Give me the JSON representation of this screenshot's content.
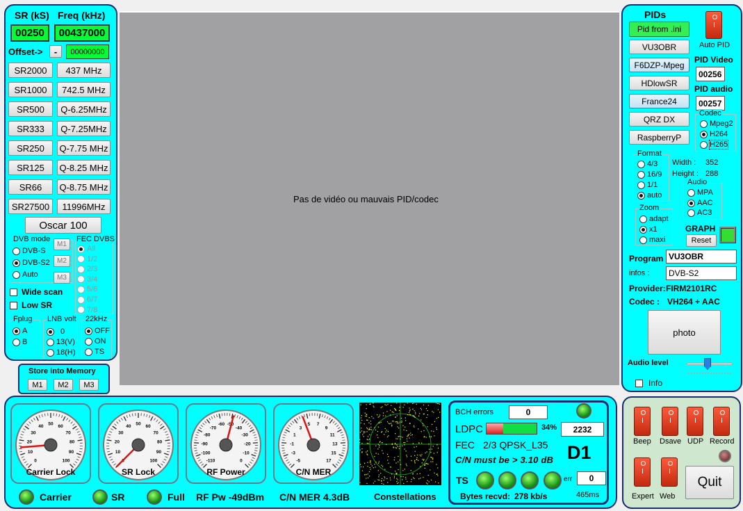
{
  "left": {
    "sr_header": "SR (kS)",
    "freq_header": "Freq (kHz)",
    "sr_value": "00250",
    "freq_value": "00437000",
    "offset_label": "Offset->",
    "offset_sign": "-",
    "offset_value": "00000000",
    "sr_buttons": [
      "SR2000",
      "SR1000",
      "SR500",
      "SR333",
      "SR250",
      "SR125",
      "SR66",
      "SR27500"
    ],
    "freq_buttons": [
      "437 MHz",
      "742.5 MHz",
      "Q-6.25MHz",
      "Q-7.25MHz",
      "Q-7.75 MHz",
      "Q-8.25 MHz",
      "Q-8.75 MHz",
      "11996MHz"
    ],
    "oscar_button": "Oscar 100",
    "dvb_mode": {
      "legend": "DVB mode",
      "options": [
        "DVB-S",
        "DVB-S2",
        "Auto"
      ],
      "selected": "DVB-S2"
    },
    "m_buttons": [
      "M1",
      "M2",
      "M3"
    ],
    "fec_dvbs": {
      "legend": "FEC DVBS",
      "options": [
        "All",
        "1/2",
        "2/3",
        "3/4",
        "5/6",
        "6/7",
        "7/8"
      ],
      "selected": "All"
    },
    "wide_scan": "Wide scan",
    "low_sr": "Low SR",
    "fplug": {
      "legend": "Fplug",
      "options": [
        "A",
        "B"
      ],
      "selected": "A"
    },
    "lnb_volt": {
      "legend": "LNB volt",
      "options": [
        "0",
        "13(V)",
        "18(H)"
      ],
      "selected": "0"
    },
    "khz22": {
      "legend": "22kHz",
      "options": [
        "OFF",
        "ON",
        "TS"
      ],
      "selected": "OFF"
    },
    "store_label": "Store into Memory",
    "store_buttons": [
      "M1",
      "M2",
      "M3"
    ]
  },
  "video": {
    "message": "Pas de vidéo ou mauvais PID/codec"
  },
  "right": {
    "pids_label": "PIDs",
    "pid_buttons": [
      "Pid from .ini",
      "VU3OBR",
      "F6DZP-Mpeg",
      "HDlowSR",
      "France24",
      "QRZ DX",
      "RaspberryP"
    ],
    "auto_pid": "Auto PID",
    "pid_video_label": "PID Video",
    "pid_video": "00256",
    "pid_audio_label": "PID audio",
    "pid_audio": "00257",
    "codec": {
      "legend": "Codec",
      "options": [
        "Mpeg2",
        "H264",
        "H265"
      ],
      "selected": "H264"
    },
    "format": {
      "legend": "Format",
      "options": [
        "4/3",
        "16/9",
        "1/1",
        "auto"
      ],
      "selected": "auto"
    },
    "width_label": "Width :",
    "width": "352",
    "height_label": "Height :",
    "height": "288",
    "audio": {
      "legend": "Audio",
      "options": [
        "MPA",
        "AAC",
        "AC3"
      ],
      "selected": "AAC"
    },
    "zoom": {
      "legend": "Zoom",
      "options": [
        "adapt",
        "x1",
        "maxi"
      ],
      "selected": "x1"
    },
    "graph_label": "GRAPH",
    "reset_label": "Reset",
    "program_label": "Program",
    "program": "VU3OBR",
    "infos_label": "infos :",
    "infos": "DVB-S2",
    "provider_label": "Provider:",
    "provider": "FIRM2101RC",
    "codec_label": "Codec :",
    "codec_value": "VH264 + AAC",
    "photo_label": "photo",
    "audio_level_label": "Audio level",
    "audio_level": 0.45,
    "info_label": "Info"
  },
  "gauges": [
    {
      "name": "Carrier Lock",
      "ticks": [
        "0",
        "10",
        "20",
        "30",
        "40",
        "50",
        "60",
        "70",
        "80",
        "90",
        "100"
      ],
      "value": 15,
      "min": 0,
      "max": 100
    },
    {
      "name": "SR Lock",
      "ticks": [
        "0",
        "10",
        "20",
        "30",
        "40",
        "50",
        "60",
        "70",
        "80",
        "90",
        "100"
      ],
      "value": 0,
      "min": 0,
      "max": 100
    },
    {
      "name": "RF Power",
      "ticks": [
        "-110",
        "-100",
        "-90",
        "-80",
        "-70",
        "-60",
        "-50",
        "-40",
        "-30",
        "-20",
        "-10",
        "0"
      ],
      "value": -49,
      "min": -110,
      "max": 0
    },
    {
      "name": "C/N MER",
      "ticks": [
        "-5",
        "-3",
        "-1",
        "1",
        "3",
        "5",
        "7",
        "9",
        "11",
        "13",
        "15",
        "17"
      ],
      "value": 4.3,
      "min": -5,
      "max": 17
    }
  ],
  "constellation_label": "Constellations",
  "status": {
    "carrier": "Carrier",
    "sr": "SR",
    "full": "Full",
    "rf_pw": "RF Pw -49dBm",
    "cn_mer": "C/N MER 4.3dB"
  },
  "demod": {
    "bch_label": "BCH errors",
    "bch": "0",
    "ldpc_label": "LDPC",
    "ldpc_pct": "34%",
    "ldpc_fraction": 0.34,
    "ldpc_count": "2232",
    "fec_label": "FEC",
    "fec": "2/3 QPSK_L35",
    "mode": "D1",
    "cn_text": "C/N must be > 3.10 dB",
    "ts_label": "TS",
    "err_label": "err",
    "err": "0",
    "bytes_label": "Bytes recvd:",
    "bytes": "278 kb/s",
    "latency": "465ms"
  },
  "controls": {
    "beep": "Beep",
    "dsave": "Dsave",
    "udp": "UDP",
    "record": "Record",
    "expert": "Expert",
    "web": "Web",
    "quit": "Quit"
  }
}
